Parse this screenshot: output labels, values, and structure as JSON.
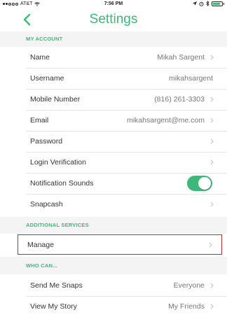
{
  "status_bar": {
    "carrier": "AT&T",
    "time": "7:56 PM",
    "battery_level": 0.85,
    "icons": [
      "signal-icon",
      "wifi-icon",
      "location-icon",
      "alarm-icon",
      "bluetooth-icon",
      "battery-icon"
    ]
  },
  "nav": {
    "title": "Settings",
    "back_icon": "chevron-left-icon"
  },
  "sections": {
    "my_account": "MY ACCOUNT",
    "additional_services": "ADDITIONAL SERVICES",
    "who_can": "WHO CAN..."
  },
  "rows": {
    "name": {
      "label": "Name",
      "value": "Mikah Sargent"
    },
    "username": {
      "label": "Username",
      "value": "mikahsargent"
    },
    "mobile_number": {
      "label": "Mobile Number",
      "value": "(816) 261-3303"
    },
    "email": {
      "label": "Email",
      "value": "mikahsargent@me.com"
    },
    "password": {
      "label": "Password"
    },
    "login_verification": {
      "label": "Login Verification"
    },
    "notification_sounds": {
      "label": "Notification Sounds",
      "enabled": true
    },
    "snapcash": {
      "label": "Snapcash"
    },
    "manage": {
      "label": "Manage"
    },
    "send_me_snaps": {
      "label": "Send Me Snaps",
      "value": "Everyone"
    },
    "view_my_story": {
      "label": "View My Story",
      "value": "My Friends"
    }
  },
  "colors": {
    "accent": "#3cb878",
    "highlight": "#c0282d",
    "section_bg": "#f4f4f4"
  }
}
